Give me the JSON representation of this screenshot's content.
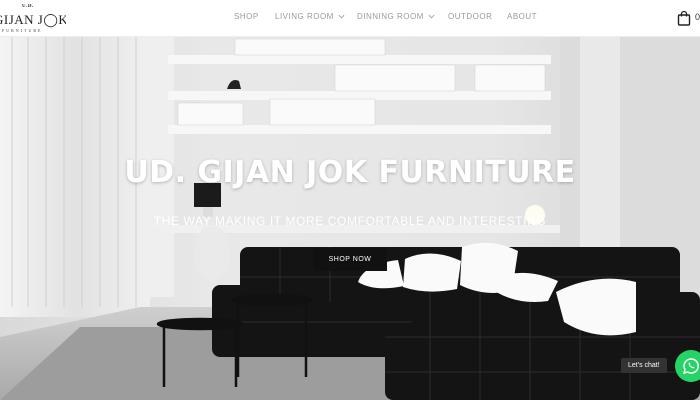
{
  "logo": {
    "ud": "U.D.",
    "name": "GIJAN J◯K",
    "sub": "FURNITURE"
  },
  "nav": {
    "items": [
      {
        "label": "SHOP"
      },
      {
        "label": "LIVING ROOM"
      },
      {
        "label": "DINNING ROOM"
      },
      {
        "label": "OUTDOOR"
      },
      {
        "label": "ABOUT"
      }
    ]
  },
  "cart": {
    "count": "0",
    "icon": "shopping-bag-icon"
  },
  "hero": {
    "title": "UD. GIJAN JOK FURNITURE",
    "subtitle": "THE WAY MAKING IT MORE COMFORTABLE AND INTERESTING",
    "button_label": "SHOP NOW"
  },
  "chat": {
    "label": "Let's chat!",
    "icon": "whatsapp-icon",
    "color": "#25d366"
  }
}
